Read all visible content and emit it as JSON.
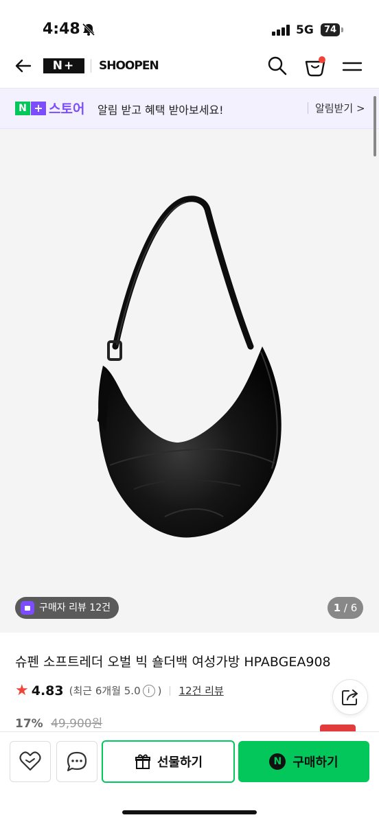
{
  "status_bar": {
    "time": "4:48",
    "network": "5G",
    "battery": "74"
  },
  "header": {
    "logo": "N+",
    "shop_name": "SHOOPEN"
  },
  "banner": {
    "badge_n": "N",
    "badge_plus": "+",
    "store_label": "스토어",
    "text": "알림 받고 혜택 받아보세요!",
    "action": "알림받기 >"
  },
  "hero": {
    "review_chip": "구매자 리뷰 12건",
    "page_current": "1",
    "page_total": "/ 6"
  },
  "product": {
    "title": "슈펜 소프트레더 오벌 빅 숄더백 여성가방 HPABGEA908",
    "rating": "4.83",
    "recent_rating": "(최근 6개월 5.0",
    "recent_rating_close": ")",
    "review_count": "12건 리뷰",
    "discount": "17%",
    "original_price": "49,900원"
  },
  "bottom_bar": {
    "gift_label": "선물하기",
    "buy_label": "구매하기",
    "buy_badge": "N"
  },
  "colors": {
    "naver_green": "#03c75a",
    "store_purple": "#7b4dff",
    "star_red": "#f04438"
  },
  "icons": [
    "back-arrow-icon",
    "search-icon",
    "cart-icon",
    "menu-icon",
    "bell-slash-icon",
    "heart-icon",
    "chat-icon",
    "gift-icon",
    "share-icon",
    "star-icon",
    "info-icon"
  ]
}
